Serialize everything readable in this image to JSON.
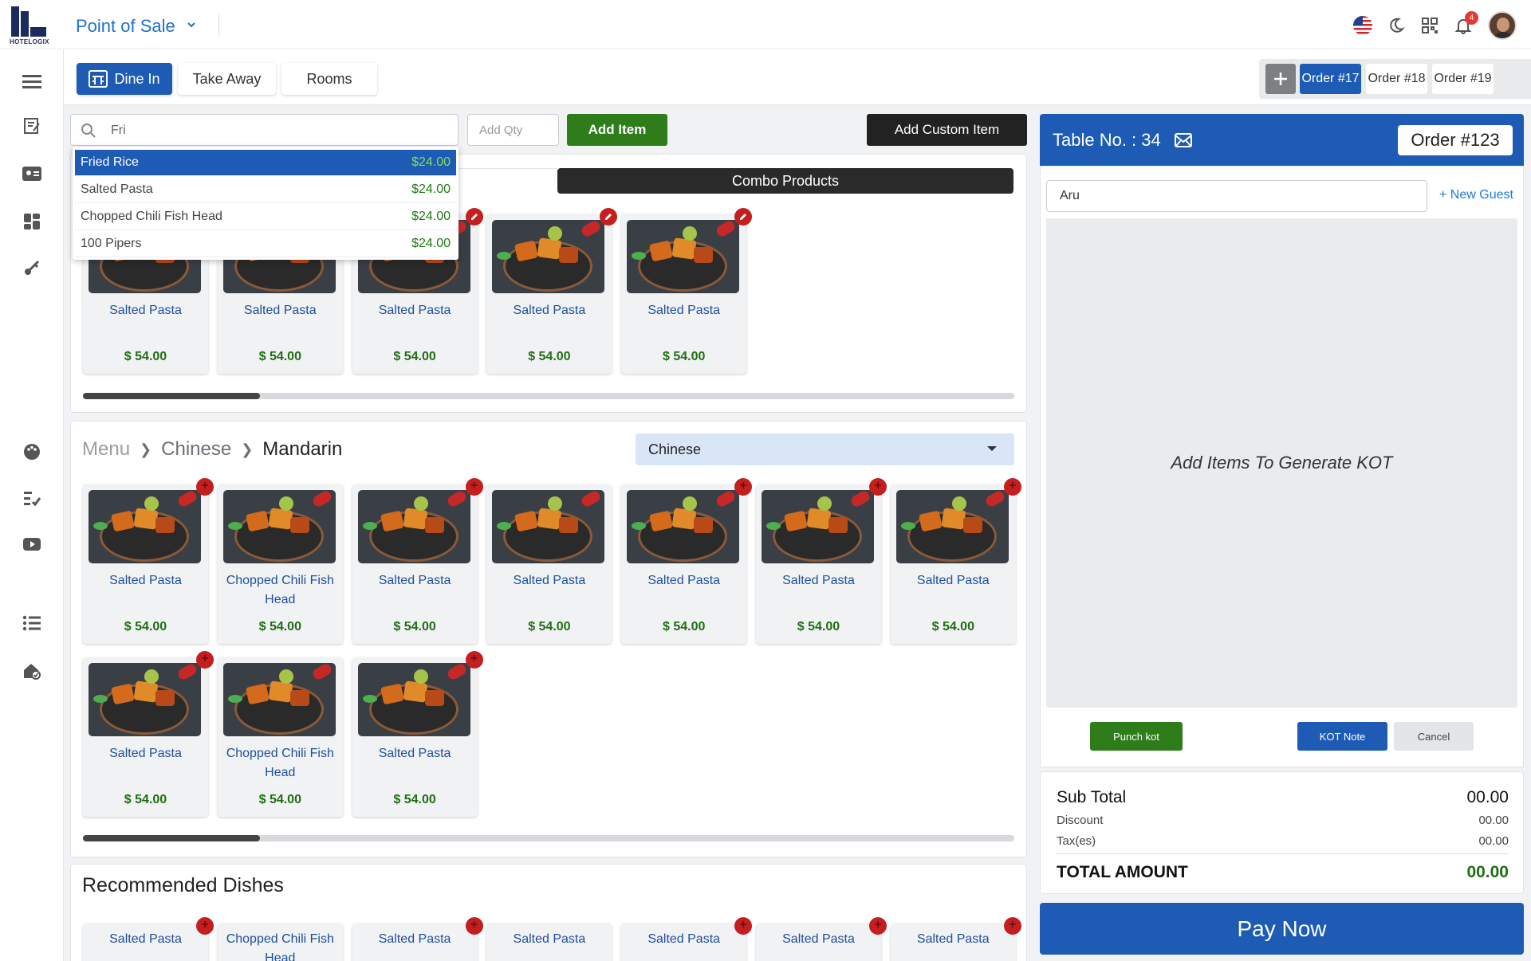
{
  "app": {
    "logo_text": "HOTELOGIX",
    "title": "Point of Sale",
    "notification_count": "4"
  },
  "order_types": [
    "Dine In",
    "Take Away",
    "Rooms"
  ],
  "open_orders": [
    "Order #17",
    "Order #18",
    "Order #19"
  ],
  "search": {
    "value": "Fri",
    "qty_placeholder": "Add Qty",
    "add_item_label": "Add Item",
    "add_custom_label": "Add Custom Item"
  },
  "suggestions": [
    {
      "name": "Fried Rice",
      "price": "$24.00"
    },
    {
      "name": "Salted Pasta",
      "price": "$24.00"
    },
    {
      "name": "Chopped Chili Fish Head",
      "price": "$24.00"
    },
    {
      "name": "100 Pipers",
      "price": "$24.00"
    }
  ],
  "combo": {
    "tab_label": "Combo Products",
    "items": [
      {
        "name": "Salted Pasta",
        "price": "$ 54.00"
      },
      {
        "name": "Salted Pasta",
        "price": "$ 54.00"
      },
      {
        "name": "Salted Pasta",
        "price": "$ 54.00"
      },
      {
        "name": "Salted Pasta",
        "price": "$ 54.00"
      },
      {
        "name": "Salted Pasta",
        "price": "$ 54.00"
      }
    ],
    "scroll_fraction": 0.19
  },
  "menu": {
    "breadcrumb": [
      "Menu",
      "Chinese",
      "Mandarin"
    ],
    "category_selected": "Chinese",
    "items": [
      {
        "name": "Salted Pasta",
        "price": "$ 54.00"
      },
      {
        "name": "Chopped Chili Fish Head",
        "price": "$ 54.00"
      },
      {
        "name": "Salted Pasta",
        "price": "$ 54.00"
      },
      {
        "name": "Salted Pasta",
        "price": "$ 54.00"
      },
      {
        "name": "Salted Pasta",
        "price": "$ 54.00"
      },
      {
        "name": "Salted Pasta",
        "price": "$ 54.00"
      },
      {
        "name": "Salted Pasta",
        "price": "$ 54.00"
      },
      {
        "name": "Salted Pasta",
        "price": "$ 54.00"
      },
      {
        "name": "Chopped Chili Fish Head",
        "price": "$ 54.00"
      },
      {
        "name": "Salted Pasta",
        "price": "$ 54.00"
      }
    ],
    "scroll_fraction": 0.19
  },
  "recommended": {
    "title": "Recommended Dishes",
    "items": [
      {
        "name": "Salted Pasta"
      },
      {
        "name": "Chopped Chili Fish Head"
      },
      {
        "name": "Salted Pasta"
      },
      {
        "name": "Salted Pasta"
      },
      {
        "name": "Salted Pasta"
      },
      {
        "name": "Salted Pasta"
      },
      {
        "name": "Salted Pasta"
      }
    ]
  },
  "order_panel": {
    "table_label": "Table No. : 34",
    "order_label": "Order #123",
    "guest_value": "Aru",
    "new_guest_label": "+ New Guest",
    "empty_message": "Add Items To Generate KOT",
    "punch_kot_label": "Punch kot",
    "kot_note_label": "KOT Note",
    "cancel_label": "Cancel"
  },
  "totals": {
    "sub_total_label": "Sub Total",
    "sub_total": "00.00",
    "discount_label": "Discount",
    "discount": "00.00",
    "tax_label": "Tax(es)",
    "tax": "00.00",
    "total_label": "TOTAL AMOUNT",
    "total": "00.00"
  },
  "pay_now_label": "Pay Now",
  "colors": {
    "primary": "#1d5bb5",
    "accent_green": "#2e7d1a",
    "danger": "#c41e1e",
    "price_green": "#1f6f12"
  }
}
